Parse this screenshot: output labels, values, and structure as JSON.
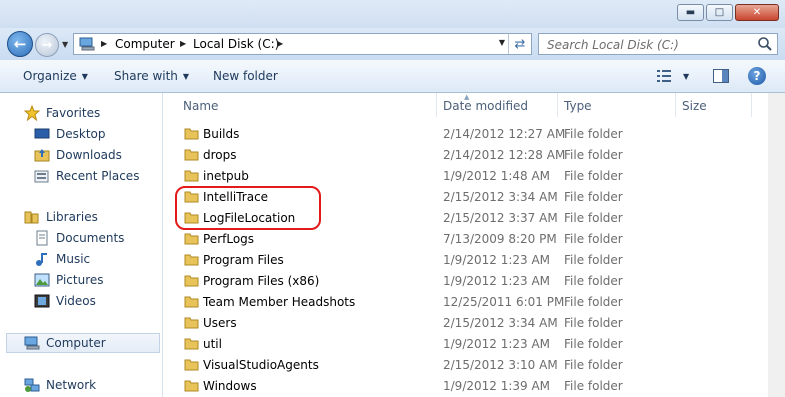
{
  "window": {
    "min_glyph": "▬",
    "max_glyph": "□",
    "close_glyph": "✕"
  },
  "address": {
    "crumbs": [
      "Computer",
      "Local Disk (C:)"
    ],
    "search_placeholder": "Search Local Disk (C:)"
  },
  "toolbar": {
    "organize": "Organize",
    "share_with": "Share with",
    "new_folder": "New folder",
    "help": "?"
  },
  "nav": {
    "favorites": "Favorites",
    "desktop": "Desktop",
    "downloads": "Downloads",
    "recent_places": "Recent Places",
    "libraries": "Libraries",
    "documents": "Documents",
    "music": "Music",
    "pictures": "Pictures",
    "videos": "Videos",
    "computer": "Computer",
    "network": "Network"
  },
  "columns": {
    "name": "Name",
    "date_modified": "Date modified",
    "type": "Type",
    "size": "Size"
  },
  "files": [
    {
      "name": "Builds",
      "date": "2/14/2012 12:27 AM",
      "type": "File folder"
    },
    {
      "name": "drops",
      "date": "2/14/2012 12:28 AM",
      "type": "File folder"
    },
    {
      "name": "inetpub",
      "date": "1/9/2012 1:48 AM",
      "type": "File folder"
    },
    {
      "name": "IntelliTrace",
      "date": "2/15/2012 3:34 AM",
      "type": "File folder"
    },
    {
      "name": "LogFileLocation",
      "date": "2/15/2012 3:37 AM",
      "type": "File folder"
    },
    {
      "name": "PerfLogs",
      "date": "7/13/2009 8:20 PM",
      "type": "File folder"
    },
    {
      "name": "Program Files",
      "date": "1/9/2012 1:23 AM",
      "type": "File folder"
    },
    {
      "name": "Program Files (x86)",
      "date": "1/9/2012 1:23 AM",
      "type": "File folder"
    },
    {
      "name": "Team Member Headshots",
      "date": "12/25/2011 6:01 PM",
      "type": "File folder"
    },
    {
      "name": "Users",
      "date": "2/15/2012 3:34 AM",
      "type": "File folder"
    },
    {
      "name": "util",
      "date": "1/9/2012 1:23 AM",
      "type": "File folder"
    },
    {
      "name": "VisualStudioAgents",
      "date": "2/15/2012 3:10 AM",
      "type": "File folder"
    },
    {
      "name": "Windows",
      "date": "1/9/2012 1:39 AM",
      "type": "File folder"
    }
  ],
  "colors": {
    "highlight": "#e21a1a",
    "folder": "#e8c35a",
    "accent": "#1e395b"
  }
}
